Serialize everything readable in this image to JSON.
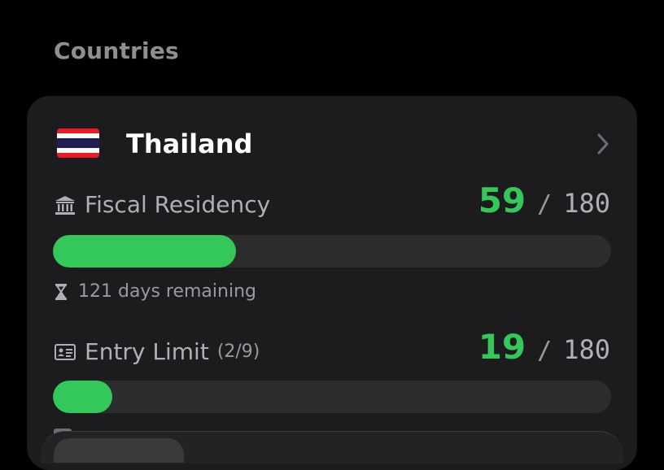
{
  "section": {
    "title": "Countries"
  },
  "country": {
    "name": "Thailand",
    "flag_icon": "thailand-flag-icon",
    "chevron_icon": "chevron-right-icon"
  },
  "fiscal": {
    "icon": "bank-building-icon",
    "label": "Fiscal Residency",
    "current": "59",
    "separator": "/",
    "max": "180",
    "progress": 0.328,
    "remaining_icon": "hourglass-icon",
    "remaining": "121 days remaining"
  },
  "entry": {
    "icon": "id-card-icon",
    "label": "Entry Limit",
    "count": "(2/9)",
    "current": "19",
    "separator": "/",
    "max": "180",
    "progress": 0.106
  },
  "colors": {
    "accent": "#34c759",
    "card": "#1c1c1e",
    "track": "#2c2c2e",
    "background": "#000000",
    "muted": "#8e8e93"
  }
}
